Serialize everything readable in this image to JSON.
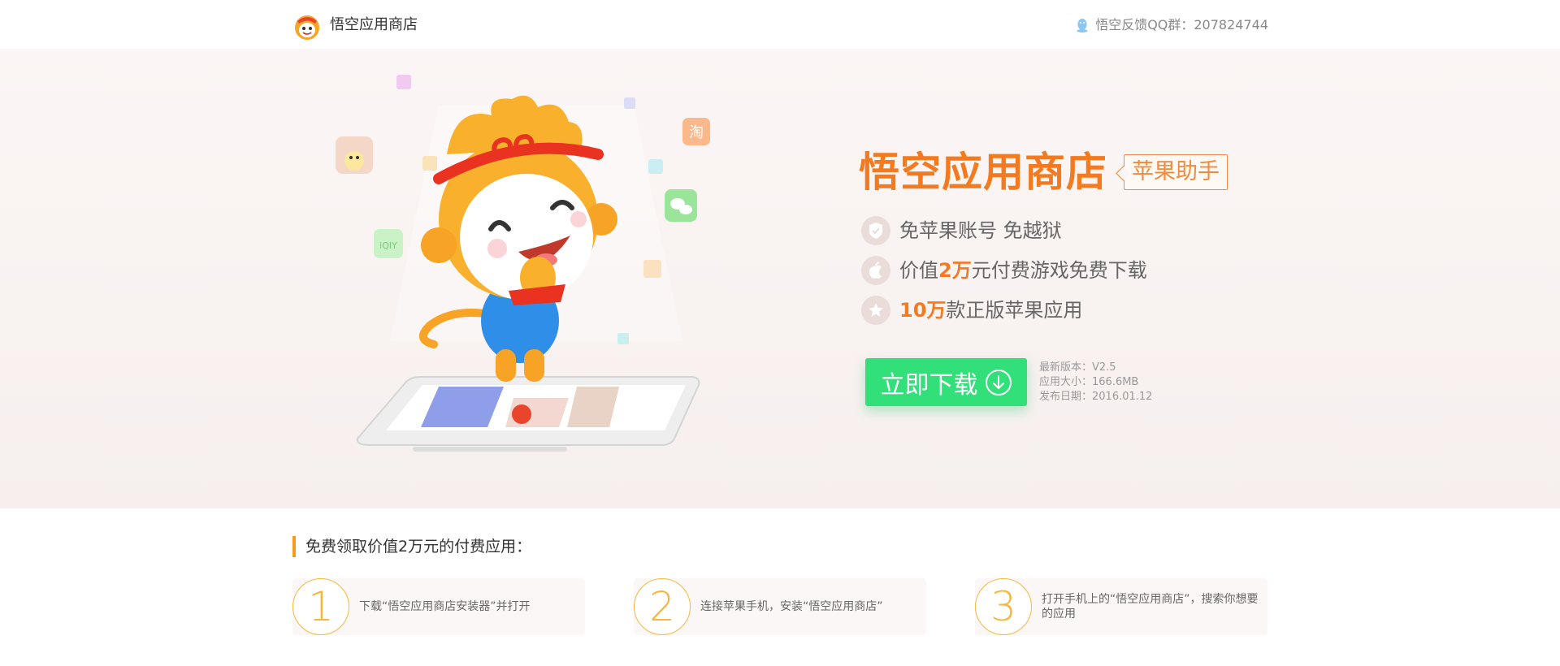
{
  "header": {
    "brand": "悟空应用商店",
    "feedback": "悟空反馈QQ群：207824744",
    "logo_icon": "monkey-logo-icon",
    "qq_icon": "qq-penguin-icon"
  },
  "hero": {
    "title": "悟空应用商店",
    "tag": "苹果助手",
    "features": [
      {
        "icon": "shield-check-icon",
        "pre": "",
        "hl": "",
        "post": "免苹果账号  免越狱"
      },
      {
        "icon": "apple-icon",
        "pre": "价值",
        "hl": "2万",
        "post": "元付费游戏免费下载"
      },
      {
        "icon": "star-icon",
        "pre": "",
        "hl": "10万",
        "post": "款正版苹果应用"
      }
    ],
    "download_label": "立即下载",
    "meta": {
      "version": "最新版本：V2.5",
      "size": "应用大小：166.6MB",
      "date": "发布日期：2016.01.12"
    }
  },
  "steps": {
    "title": "免费领取价值2万元的付费应用：",
    "items": [
      {
        "num": "1",
        "text": "下载“悟空应用商店安装器”并打开"
      },
      {
        "num": "2",
        "text": "连接苹果手机，安装“悟空应用商店”"
      },
      {
        "num": "3",
        "text": "打开手机上的“悟空应用商店”，搜索你想要的应用"
      }
    ]
  },
  "colors": {
    "accent": "#f47a20",
    "download": "#32e07a",
    "step_circle": "#f6b740"
  }
}
